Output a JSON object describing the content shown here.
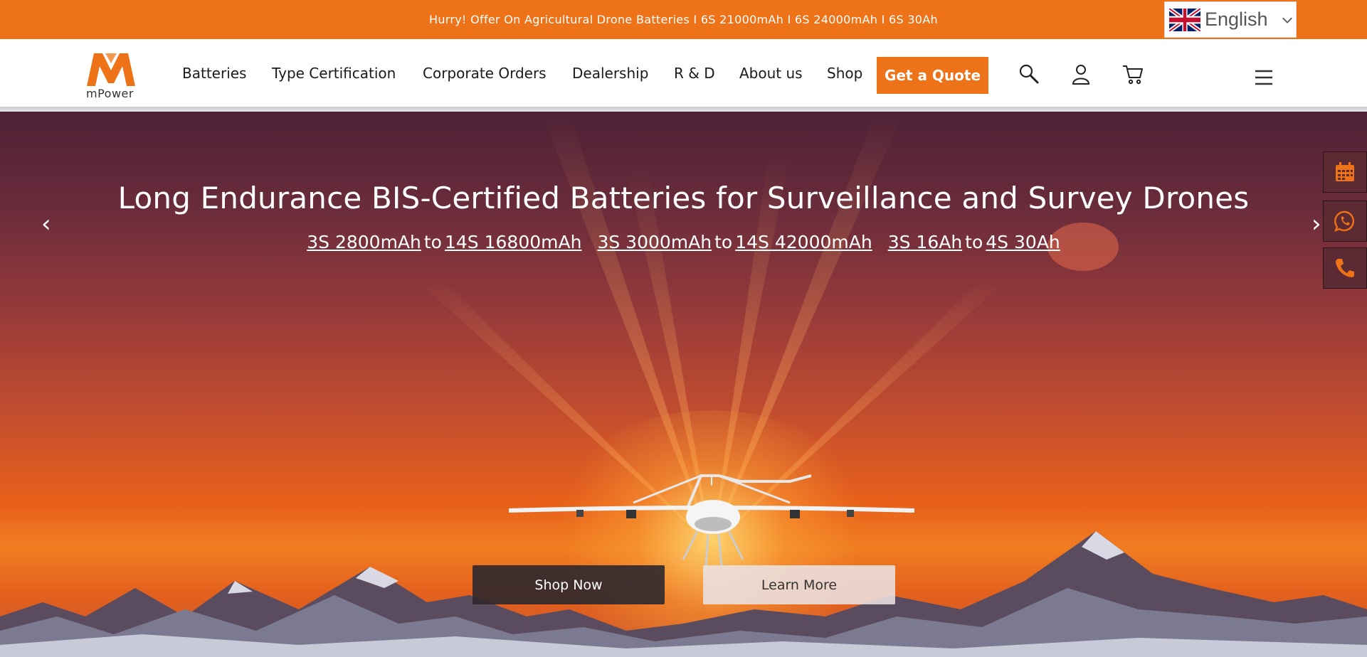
{
  "announcement": {
    "text": "Hurry! Offer On Agricultural Drone Batteries I 6S 21000mAh I 6S 24000mAh I 6S 30Ah"
  },
  "language": {
    "label": "English"
  },
  "logo": {
    "text": "mPower"
  },
  "nav": {
    "items": [
      {
        "label": "Batteries"
      },
      {
        "label": "Type Certification"
      },
      {
        "label": "Corporate Orders"
      },
      {
        "label": "Dealership"
      },
      {
        "label": "R & D"
      },
      {
        "label": "About us"
      },
      {
        "label": "Shop"
      }
    ],
    "quote_label": "Get a Quote"
  },
  "hero": {
    "title": "Long Endurance BIS-Certified Batteries for Surveillance and Survey Drones",
    "ranges": [
      {
        "from": "3S 2800mAh",
        "to_word": "to",
        "to": "14S 16800mAh"
      },
      {
        "from": "3S 3000mAh",
        "to_word": "to",
        "to": "14S 42000mAh"
      },
      {
        "from": "3S 16Ah",
        "to_word": "to",
        "to": "4S 30Ah"
      }
    ],
    "prev_arrow": "‹",
    "next_arrow": "›",
    "shop_label": "Shop Now",
    "learn_label": "Learn More"
  },
  "colors": {
    "accent": "#ee7218",
    "side_button": "#5b2a33"
  },
  "icons": {
    "header": [
      "search-icon",
      "user-icon",
      "cart-icon",
      "menu-icon"
    ],
    "side": [
      "calendar-icon",
      "whatsapp-icon",
      "phone-icon"
    ],
    "language": [
      "uk-flag-icon",
      "chevron-down-icon"
    ]
  }
}
